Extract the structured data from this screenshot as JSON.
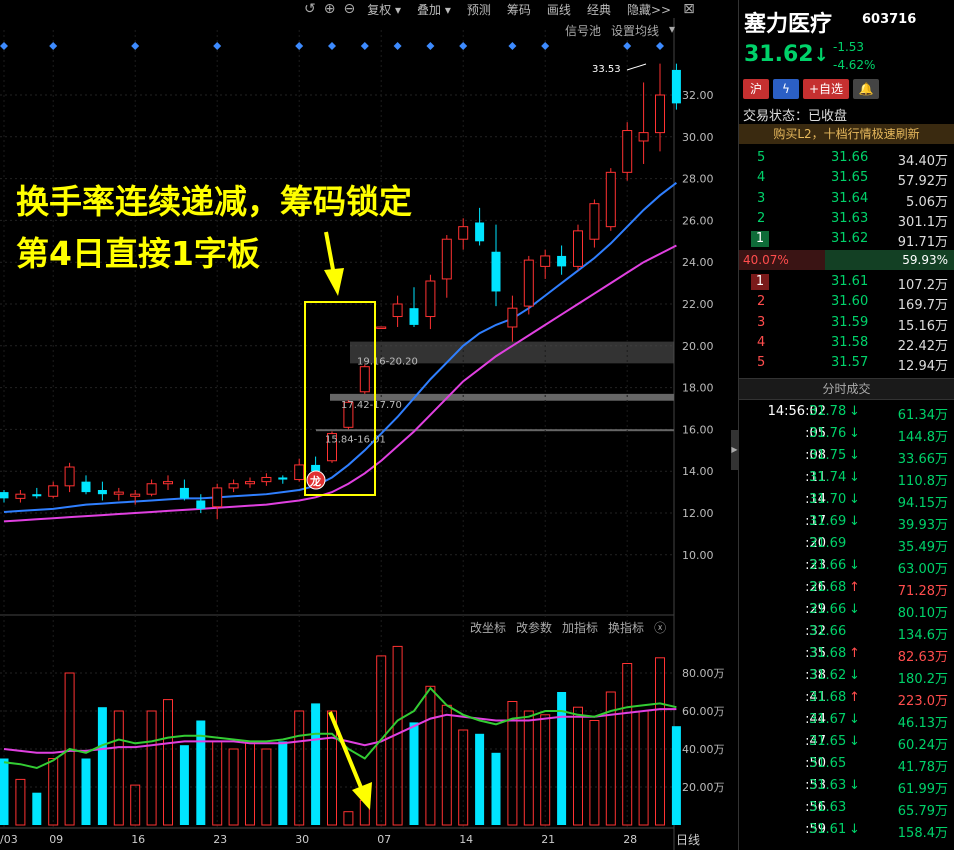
{
  "colors": {
    "up": "#ff3232",
    "down": "#00e5ff",
    "ma_blue": "#2f7fff",
    "ma_magenta": "#e040e0",
    "highlight": "#ffff00",
    "green_text": "#00d26a",
    "red_text": "#ff4d4d"
  },
  "toolbar": {
    "icons": [
      "undo-icon",
      "zoom-in-icon",
      "zoom-out-icon"
    ],
    "items": [
      {
        "label": "复权 ▾"
      },
      {
        "label": "叠加 ▾"
      },
      {
        "label": "预测"
      },
      {
        "label": "筹码"
      },
      {
        "label": "画线"
      },
      {
        "label": "经典"
      },
      {
        "label": "隐藏>>"
      }
    ],
    "close": "⊠"
  },
  "sub_toolbar": {
    "signal": "信号池",
    "ma_settings": "设置均线",
    "arrow": "▾"
  },
  "indicator_toolbar": {
    "items": [
      "改坐标",
      "改参数",
      "加指标",
      "换指标"
    ],
    "close": "ⓧ"
  },
  "annotation": {
    "line1": "换手率连续递减，筹码锁定",
    "line2": "第4日直接1字板"
  },
  "chart_data": {
    "type": "candlestick",
    "price_axis": {
      "ticks": [
        "32.00",
        "30.00",
        "28.00",
        "26.00",
        "24.00",
        "22.00",
        "20.00",
        "18.00",
        "16.00",
        "14.00",
        "12.00",
        "10.00"
      ],
      "ylim": [
        10,
        32
      ]
    },
    "date_labels": [
      {
        "label": "/03",
        "index": 0
      },
      {
        "label": "09",
        "index": 3
      },
      {
        "label": "16",
        "index": 8
      },
      {
        "label": "23",
        "index": 13
      },
      {
        "label": "30",
        "index": 18
      },
      {
        "label": "07",
        "index": 23
      },
      {
        "label": "14",
        "index": 28
      },
      {
        "label": "21",
        "index": 33
      },
      {
        "label": "28",
        "index": 38
      }
    ],
    "max_label": "33.53",
    "gap_labels": [
      "15.84-16.01",
      "17.42-17.70",
      "19.16-20.20"
    ],
    "candles": [
      {
        "o": 13.0,
        "h": 13.1,
        "l": 12.5,
        "c": 12.7
      },
      {
        "o": 12.7,
        "h": 13.1,
        "l": 12.5,
        "c": 12.9
      },
      {
        "o": 12.9,
        "h": 13.2,
        "l": 12.7,
        "c": 12.8
      },
      {
        "o": 12.8,
        "h": 13.5,
        "l": 12.7,
        "c": 13.3
      },
      {
        "o": 13.3,
        "h": 14.4,
        "l": 13.0,
        "c": 14.2
      },
      {
        "o": 13.5,
        "h": 13.8,
        "l": 12.9,
        "c": 13.0
      },
      {
        "o": 13.1,
        "h": 13.5,
        "l": 12.6,
        "c": 12.9
      },
      {
        "o": 12.9,
        "h": 13.2,
        "l": 12.6,
        "c": 13.0
      },
      {
        "o": 12.8,
        "h": 13.1,
        "l": 12.4,
        "c": 12.9
      },
      {
        "o": 12.9,
        "h": 13.6,
        "l": 12.8,
        "c": 13.4
      },
      {
        "o": 13.4,
        "h": 13.8,
        "l": 13.1,
        "c": 13.5
      },
      {
        "o": 13.2,
        "h": 13.6,
        "l": 12.6,
        "c": 12.7
      },
      {
        "o": 12.6,
        "h": 12.9,
        "l": 12.0,
        "c": 12.2
      },
      {
        "o": 12.3,
        "h": 13.4,
        "l": 11.7,
        "c": 13.2
      },
      {
        "o": 13.2,
        "h": 13.6,
        "l": 13.0,
        "c": 13.4
      },
      {
        "o": 13.4,
        "h": 13.7,
        "l": 13.2,
        "c": 13.5
      },
      {
        "o": 13.5,
        "h": 13.9,
        "l": 13.3,
        "c": 13.7
      },
      {
        "o": 13.7,
        "h": 13.8,
        "l": 13.4,
        "c": 13.6
      },
      {
        "o": 13.6,
        "h": 14.6,
        "l": 13.5,
        "c": 14.3
      },
      {
        "o": 14.3,
        "h": 14.7,
        "l": 13.9,
        "c": 14.0
      },
      {
        "o": 14.5,
        "h": 15.9,
        "l": 14.4,
        "c": 15.8
      },
      {
        "o": 16.1,
        "h": 17.4,
        "l": 16.0,
        "c": 17.3
      },
      {
        "o": 17.8,
        "h": 19.1,
        "l": 17.7,
        "c": 19.0
      },
      {
        "o": 20.9,
        "h": 20.9,
        "l": 20.9,
        "c": 20.9
      },
      {
        "o": 21.4,
        "h": 22.4,
        "l": 20.9,
        "c": 22.0
      },
      {
        "o": 21.8,
        "h": 22.8,
        "l": 20.9,
        "c": 21.0
      },
      {
        "o": 21.4,
        "h": 23.4,
        "l": 20.8,
        "c": 23.1
      },
      {
        "o": 23.2,
        "h": 25.3,
        "l": 22.3,
        "c": 25.1
      },
      {
        "o": 25.1,
        "h": 26.1,
        "l": 24.6,
        "c": 25.7
      },
      {
        "o": 25.9,
        "h": 26.6,
        "l": 24.8,
        "c": 25.0
      },
      {
        "o": 24.5,
        "h": 25.8,
        "l": 21.9,
        "c": 22.6
      },
      {
        "o": 20.9,
        "h": 22.4,
        "l": 20.2,
        "c": 21.8
      },
      {
        "o": 21.9,
        "h": 24.3,
        "l": 21.5,
        "c": 24.1
      },
      {
        "o": 23.8,
        "h": 24.6,
        "l": 23.2,
        "c": 24.3
      },
      {
        "o": 24.3,
        "h": 24.8,
        "l": 23.4,
        "c": 23.8
      },
      {
        "o": 23.8,
        "h": 25.8,
        "l": 23.6,
        "c": 25.5
      },
      {
        "o": 25.1,
        "h": 27.0,
        "l": 24.7,
        "c": 26.8
      },
      {
        "o": 25.7,
        "h": 28.5,
        "l": 25.5,
        "c": 28.3
      },
      {
        "o": 28.3,
        "h": 30.7,
        "l": 27.9,
        "c": 30.3
      },
      {
        "o": 29.8,
        "h": 32.6,
        "l": 28.7,
        "c": 30.2
      },
      {
        "o": 30.2,
        "h": 33.5,
        "l": 29.3,
        "c": 32.0
      },
      {
        "o": 33.2,
        "h": 33.5,
        "l": 31.3,
        "c": 31.6
      }
    ],
    "ma_blue": [
      12.05,
      12.1,
      12.15,
      12.2,
      12.3,
      12.4,
      12.45,
      12.5,
      12.55,
      12.6,
      12.65,
      12.7,
      12.7,
      12.75,
      12.8,
      12.85,
      12.9,
      13.0,
      13.1,
      13.3,
      13.7,
      14.3,
      15.0,
      15.8,
      16.6,
      17.5,
      18.4,
      19.2,
      20.0,
      20.6,
      21.0,
      21.3,
      21.8,
      22.4,
      23.0,
      23.6,
      24.2,
      24.9,
      25.7,
      26.5,
      27.2,
      27.8
    ],
    "ma_magenta": [
      11.6,
      11.65,
      11.7,
      11.75,
      11.8,
      11.85,
      11.9,
      11.95,
      12.0,
      12.05,
      12.1,
      12.15,
      12.2,
      12.25,
      12.3,
      12.35,
      12.4,
      12.5,
      12.6,
      12.75,
      13.0,
      13.4,
      13.9,
      14.5,
      15.2,
      15.9,
      16.7,
      17.5,
      18.3,
      18.9,
      19.5,
      20.0,
      20.5,
      21.0,
      21.5,
      22.0,
      22.5,
      23.0,
      23.5,
      24.0,
      24.4,
      24.8
    ],
    "signal_marker_indices": [
      0,
      3,
      8,
      13,
      18,
      20,
      22,
      24,
      26,
      28,
      31,
      33,
      38,
      40
    ],
    "volume_axis": {
      "ticks": [
        "80.00万",
        "60.00万",
        "40.00万",
        "20.00万"
      ],
      "ylim": [
        0,
        95
      ]
    },
    "volume": [
      35,
      24,
      17,
      35,
      80,
      35,
      62,
      60,
      21,
      60,
      66,
      42,
      55,
      44,
      40,
      44,
      40,
      44,
      60,
      64,
      60,
      7,
      13,
      89,
      94,
      54,
      73,
      63,
      50,
      48,
      38,
      65,
      60,
      58,
      70,
      62,
      55,
      70,
      85,
      60,
      88,
      52
    ],
    "vol_ma_green": [
      33,
      32,
      30,
      34,
      40,
      38,
      42,
      45,
      43,
      44,
      46,
      47,
      47,
      46,
      45,
      44,
      44,
      45,
      47,
      48,
      48,
      40,
      35,
      45,
      55,
      60,
      72,
      63,
      58,
      55,
      53,
      56,
      57,
      60,
      60,
      58,
      57,
      60,
      62,
      63,
      64,
      62
    ],
    "vol_ma_magenta": [
      40,
      39,
      38,
      38,
      39,
      39,
      40,
      41,
      41,
      42,
      43,
      44,
      44,
      44,
      44,
      43,
      43,
      43,
      44,
      45,
      46,
      44,
      42,
      44,
      48,
      52,
      56,
      58,
      57,
      56,
      55,
      55,
      55,
      56,
      57,
      57,
      57,
      58,
      59,
      60,
      61,
      61
    ]
  },
  "period_label": "日线",
  "stock": {
    "name": "塞力医疗",
    "code": "603716",
    "price": "31.62",
    "price_arrow": "↓",
    "change": "-1.53",
    "pct": "-4.62%"
  },
  "tags": [
    {
      "label": "沪"
    },
    {
      "label": "ϟ"
    },
    {
      "label": "+自选"
    },
    {
      "label": "🔔"
    }
  ],
  "status": "交易状态：已收盘",
  "banner": "购买L2，十档行情极速刷新",
  "asks": [
    {
      "level": "5",
      "price": "31.66",
      "vol": "34.40万"
    },
    {
      "level": "4",
      "price": "31.65",
      "vol": "57.92万"
    },
    {
      "level": "3",
      "price": "31.64",
      "vol": "5.06万"
    },
    {
      "level": "2",
      "price": "31.63",
      "vol": "301.1万"
    },
    {
      "level": "1",
      "price": "31.62",
      "vol": "91.71万"
    }
  ],
  "ratio": {
    "buy": "40.07%",
    "sell": "59.93%",
    "buy_frac": 0.4007
  },
  "bids": [
    {
      "level": "1",
      "price": "31.61",
      "vol": "107.2万"
    },
    {
      "level": "2",
      "price": "31.60",
      "vol": "169.7万"
    },
    {
      "level": "3",
      "price": "31.59",
      "vol": "15.16万"
    },
    {
      "level": "4",
      "price": "31.58",
      "vol": "22.42万"
    },
    {
      "level": "5",
      "price": "31.57",
      "vol": "12.94万"
    }
  ],
  "ticks_title": "分时成交",
  "ticks": [
    {
      "time": "14:56:02",
      "price": "31.78",
      "dir": "↓",
      "vol": "61.34万"
    },
    {
      "time": ":05",
      "price": "31.76",
      "dir": "↓",
      "vol": "144.8万"
    },
    {
      "time": ":08",
      "price": "31.75",
      "dir": "↓",
      "vol": "33.66万"
    },
    {
      "time": ":11",
      "price": "31.74",
      "dir": "↓",
      "vol": "110.8万"
    },
    {
      "time": ":14",
      "price": "31.70",
      "dir": "↓",
      "vol": "94.15万"
    },
    {
      "time": ":17",
      "price": "31.69",
      "dir": "↓",
      "vol": "39.93万"
    },
    {
      "time": ":20",
      "price": "31.69",
      "dir": "",
      "vol": "35.49万"
    },
    {
      "time": ":23",
      "price": "31.66",
      "dir": "↓",
      "vol": "63.00万"
    },
    {
      "time": ":26",
      "price": "31.68",
      "dir": "↑",
      "vol": "71.28万"
    },
    {
      "time": ":29",
      "price": "31.66",
      "dir": "↓",
      "vol": "80.10万"
    },
    {
      "time": ":32",
      "price": "31.66",
      "dir": "",
      "vol": "134.6万"
    },
    {
      "time": ":35",
      "price": "31.68",
      "dir": "↑",
      "vol": "82.63万"
    },
    {
      "time": ":38",
      "price": "31.62",
      "dir": "↓",
      "vol": "180.2万"
    },
    {
      "time": ":41",
      "price": "31.68",
      "dir": "↑",
      "vol": "223.0万"
    },
    {
      "time": ":44",
      "price": "31.67",
      "dir": "↓",
      "vol": "46.13万"
    },
    {
      "time": ":47",
      "price": "31.65",
      "dir": "↓",
      "vol": "60.24万"
    },
    {
      "time": ":50",
      "price": "31.65",
      "dir": "",
      "vol": "41.78万"
    },
    {
      "time": ":53",
      "price": "31.63",
      "dir": "↓",
      "vol": "61.99万"
    },
    {
      "time": ":56",
      "price": "31.63",
      "dir": "",
      "vol": "65.79万"
    },
    {
      "time": ":59",
      "price": "31.61",
      "dir": "↓",
      "vol": "158.4万"
    }
  ]
}
